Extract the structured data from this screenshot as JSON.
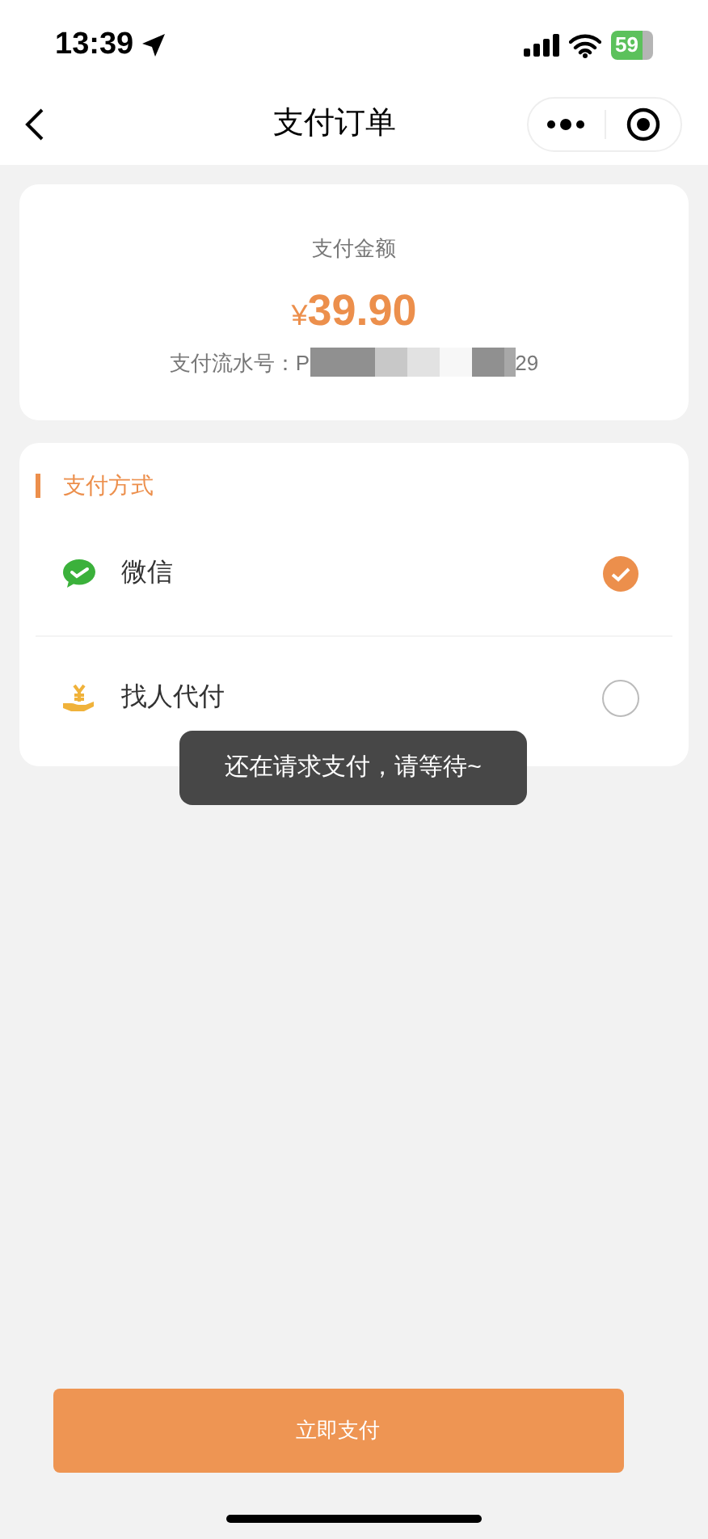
{
  "status_bar": {
    "time": "13:39",
    "battery": "59"
  },
  "nav": {
    "title": "支付订单"
  },
  "amount_card": {
    "label": "支付金额",
    "currency": "¥",
    "amount": "39.90",
    "serial_label": "支付流水号：P",
    "serial_tail": "29"
  },
  "payment_section": {
    "title": "支付方式",
    "methods": [
      {
        "kind": "wechat",
        "label": "微信",
        "selected": true
      },
      {
        "kind": "helper",
        "label": "找人代付",
        "selected": false
      }
    ]
  },
  "toast": "还在请求支付，请等待~",
  "pay_button": "立即支付"
}
